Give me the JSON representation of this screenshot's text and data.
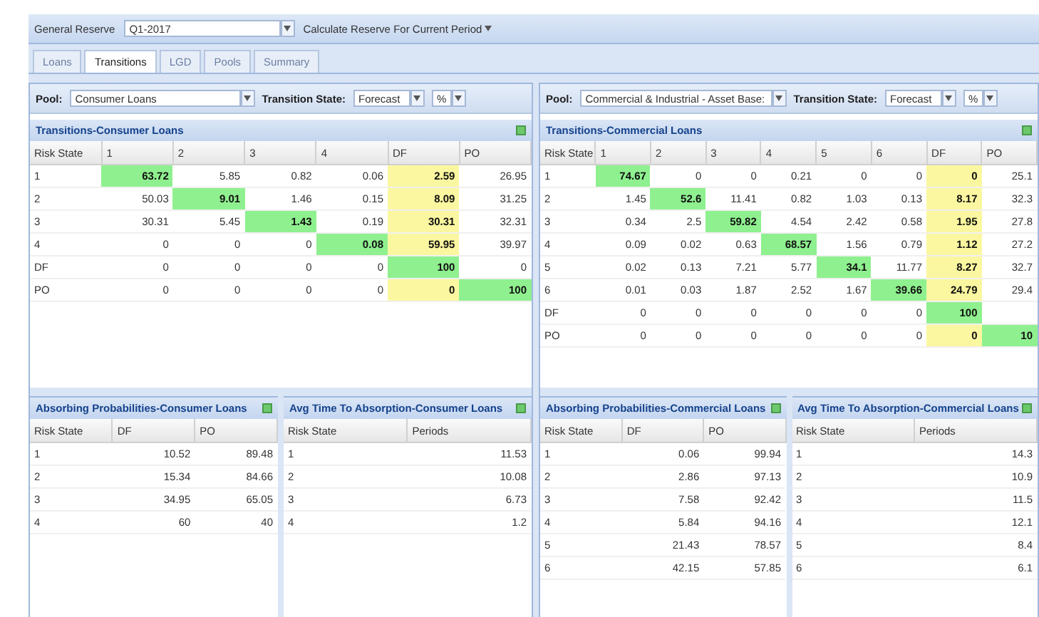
{
  "toolbar": {
    "label": "General Reserve",
    "period": "Q1-2017",
    "action": "Calculate Reserve For Current Period"
  },
  "tabs": [
    {
      "label": "Loans",
      "selected": false
    },
    {
      "label": "Transitions",
      "selected": true
    },
    {
      "label": "LGD",
      "selected": false
    },
    {
      "label": "Pools",
      "selected": false
    },
    {
      "label": "Summary",
      "selected": false
    }
  ],
  "panels": [
    {
      "pool_label": "Pool:",
      "pool": "Consumer Loans",
      "state_label": "Transition State:",
      "state": "Forecast",
      "unit": "%",
      "transitions": {
        "title": "Transitions-Consumer Loans",
        "columns": [
          "Risk State",
          "1",
          "2",
          "3",
          "4",
          "DF",
          "PO"
        ],
        "rows": [
          [
            {
              "text": "1"
            },
            {
              "text": "63.72",
              "color": "#8ff08f"
            },
            {
              "text": "5.85"
            },
            {
              "text": "0.82"
            },
            {
              "text": "0.06"
            },
            {
              "text": "2.59",
              "color": "#fbf7a0"
            },
            {
              "text": "26.95"
            }
          ],
          [
            {
              "text": "2"
            },
            {
              "text": "50.03"
            },
            {
              "text": "9.01",
              "color": "#8ff08f"
            },
            {
              "text": "1.46"
            },
            {
              "text": "0.15"
            },
            {
              "text": "8.09",
              "color": "#fbf7a0"
            },
            {
              "text": "31.25"
            }
          ],
          [
            {
              "text": "3"
            },
            {
              "text": "30.31"
            },
            {
              "text": "5.45"
            },
            {
              "text": "1.43",
              "color": "#8ff08f"
            },
            {
              "text": "0.19"
            },
            {
              "text": "30.31",
              "color": "#fbf7a0"
            },
            {
              "text": "32.31"
            }
          ],
          [
            {
              "text": "4"
            },
            {
              "text": "0"
            },
            {
              "text": "0"
            },
            {
              "text": "0"
            },
            {
              "text": "0.08",
              "color": "#8ff08f"
            },
            {
              "text": "59.95",
              "color": "#fbf7a0"
            },
            {
              "text": "39.97"
            }
          ],
          [
            {
              "text": "DF"
            },
            {
              "text": "0"
            },
            {
              "text": "0"
            },
            {
              "text": "0"
            },
            {
              "text": "0"
            },
            {
              "text": "100",
              "color": "#8ff08f"
            },
            {
              "text": "0"
            }
          ],
          [
            {
              "text": "PO"
            },
            {
              "text": "0"
            },
            {
              "text": "0"
            },
            {
              "text": "0"
            },
            {
              "text": "0"
            },
            {
              "text": "0",
              "color": "#fbf7a0"
            },
            {
              "text": "100",
              "color": "#8ff08f"
            }
          ]
        ]
      },
      "absorbing": {
        "title": "Absorbing Probabilities-Consumer Loans",
        "columns": [
          "Risk State",
          "DF",
          "PO"
        ],
        "rows": [
          [
            "1",
            "10.52",
            "89.48"
          ],
          [
            "2",
            "15.34",
            "84.66"
          ],
          [
            "3",
            "34.95",
            "65.05"
          ],
          [
            "4",
            "60",
            "40"
          ]
        ]
      },
      "avg_time": {
        "title": "Avg Time To Absorption-Consumer Loans",
        "columns": [
          "Risk State",
          "Periods"
        ],
        "rows": [
          [
            "1",
            "11.53"
          ],
          [
            "2",
            "10.08"
          ],
          [
            "3",
            "6.73"
          ],
          [
            "4",
            "1.2"
          ]
        ]
      }
    },
    {
      "pool_label": "Pool:",
      "pool": "Commercial & Industrial - Asset Base:",
      "state_label": "Transition State:",
      "state": "Forecast",
      "unit": "%",
      "transitions": {
        "title": "Transitions-Commercial Loans",
        "columns": [
          "Risk State",
          "1",
          "2",
          "3",
          "4",
          "5",
          "6",
          "DF",
          "PO"
        ],
        "rows": [
          [
            {
              "text": "1"
            },
            {
              "text": "74.67",
              "color": "#8ff08f"
            },
            {
              "text": "0"
            },
            {
              "text": "0"
            },
            {
              "text": "0.21"
            },
            {
              "text": "0"
            },
            {
              "text": "0"
            },
            {
              "text": "0",
              "color": "#fbf7a0"
            },
            {
              "text": "25.1"
            }
          ],
          [
            {
              "text": "2"
            },
            {
              "text": "1.45"
            },
            {
              "text": "52.6",
              "color": "#8ff08f"
            },
            {
              "text": "11.41"
            },
            {
              "text": "0.82"
            },
            {
              "text": "1.03"
            },
            {
              "text": "0.13"
            },
            {
              "text": "8.17",
              "color": "#fbf7a0"
            },
            {
              "text": "32.3"
            }
          ],
          [
            {
              "text": "3"
            },
            {
              "text": "0.34"
            },
            {
              "text": "2.5"
            },
            {
              "text": "59.82",
              "color": "#8ff08f"
            },
            {
              "text": "4.54"
            },
            {
              "text": "2.42"
            },
            {
              "text": "0.58"
            },
            {
              "text": "1.95",
              "color": "#fbf7a0"
            },
            {
              "text": "27.8"
            }
          ],
          [
            {
              "text": "4"
            },
            {
              "text": "0.09"
            },
            {
              "text": "0.02"
            },
            {
              "text": "0.63"
            },
            {
              "text": "68.57",
              "color": "#8ff08f"
            },
            {
              "text": "1.56"
            },
            {
              "text": "0.79"
            },
            {
              "text": "1.12",
              "color": "#fbf7a0"
            },
            {
              "text": "27.2"
            }
          ],
          [
            {
              "text": "5"
            },
            {
              "text": "0.02"
            },
            {
              "text": "0.13"
            },
            {
              "text": "7.21"
            },
            {
              "text": "5.77"
            },
            {
              "text": "34.1",
              "color": "#8ff08f"
            },
            {
              "text": "11.77"
            },
            {
              "text": "8.27",
              "color": "#fbf7a0"
            },
            {
              "text": "32.7"
            }
          ],
          [
            {
              "text": "6"
            },
            {
              "text": "0.01"
            },
            {
              "text": "0.03"
            },
            {
              "text": "1.87"
            },
            {
              "text": "2.52"
            },
            {
              "text": "1.67"
            },
            {
              "text": "39.66",
              "color": "#8ff08f"
            },
            {
              "text": "24.79",
              "color": "#fbf7a0"
            },
            {
              "text": "29.4"
            }
          ],
          [
            {
              "text": "DF"
            },
            {
              "text": "0"
            },
            {
              "text": "0"
            },
            {
              "text": "0"
            },
            {
              "text": "0"
            },
            {
              "text": "0"
            },
            {
              "text": "0"
            },
            {
              "text": "100",
              "color": "#8ff08f"
            }
          ],
          [
            {
              "text": "PO"
            },
            {
              "text": "0"
            },
            {
              "text": "0"
            },
            {
              "text": "0"
            },
            {
              "text": "0"
            },
            {
              "text": "0"
            },
            {
              "text": "0"
            },
            {
              "text": "0",
              "color": "#fbf7a0"
            },
            {
              "text": "10",
              "color": "#8ff08f"
            }
          ]
        ]
      },
      "absorbing": {
        "title": "Absorbing Probabilities-Commercial Loans",
        "columns": [
          "Risk State",
          "DF",
          "PO"
        ],
        "rows": [
          [
            "1",
            "0.06",
            "99.94"
          ],
          [
            "2",
            "2.86",
            "97.13"
          ],
          [
            "3",
            "7.58",
            "92.42"
          ],
          [
            "4",
            "5.84",
            "94.16"
          ],
          [
            "5",
            "21.43",
            "78.57"
          ],
          [
            "6",
            "42.15",
            "57.85"
          ]
        ]
      },
      "avg_time": {
        "title": "Avg Time To Absorption-Commercial Loans",
        "columns": [
          "Risk State",
          "Periods"
        ],
        "rows": [
          [
            "1",
            "14.3"
          ],
          [
            "2",
            "10.9"
          ],
          [
            "3",
            "11.5"
          ],
          [
            "4",
            "12.1"
          ],
          [
            "5",
            "8.4"
          ],
          [
            "6",
            "6.1"
          ]
        ]
      }
    }
  ]
}
